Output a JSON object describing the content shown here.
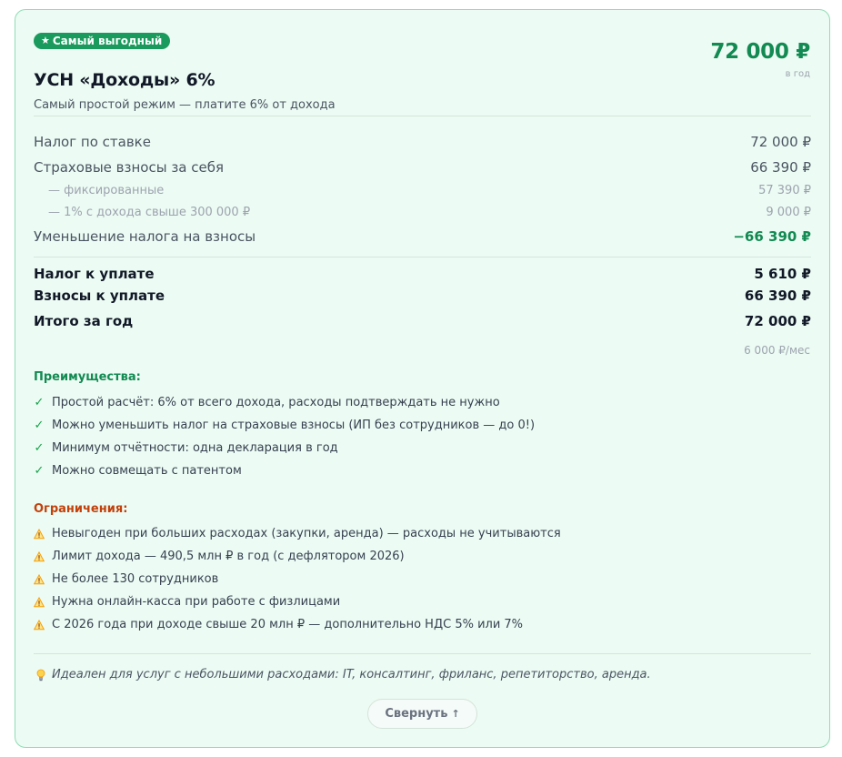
{
  "card": {
    "badge": "Самый выгодный",
    "title": "УСН «Доходы» 6%",
    "subtitle": "Самый простой режим — платите 6% от дохода",
    "price": "72 000 ₽",
    "period": "в год"
  },
  "breakdown": [
    {
      "label": "Налог по ставке",
      "value": "72 000 ₽"
    },
    {
      "label": "Страховые взносы за себя",
      "value": "66 390 ₽"
    },
    {
      "label": "— фиксированные",
      "value": "57 390 ₽"
    },
    {
      "label": "— 1% с дохода свыше 300 000 ₽",
      "value": "9 000 ₽"
    },
    {
      "label": "Уменьшение налога на взносы",
      "value": "−66 390 ₽"
    }
  ],
  "totals": [
    {
      "label": "Налог к уплате",
      "value": "5 610 ₽"
    },
    {
      "label": "Взносы к уплате",
      "value": "66 390 ₽"
    },
    {
      "label": "Итого за год",
      "value": "72 000 ₽"
    }
  ],
  "monthly": "6 000 ₽/мес",
  "advantages": {
    "title": "Преимущества:",
    "items": [
      "Простой расчёт: 6% от всего дохода, расходы подтверждать не нужно",
      "Можно уменьшить налог на страховые взносы (ИП без сотрудников — до 0!)",
      "Минимум отчётности: одна декларация в год",
      "Можно совмещать с патентом"
    ]
  },
  "limitations": {
    "title": "Ограничения:",
    "items": [
      "Невыгоден при больших расходах (закупки, аренда) — расходы не учитываются",
      "Лимит дохода — 490,5 млн ₽ в год (с дефлятором 2026)",
      "Не более 130 сотрудников",
      "Нужна онлайн-касса при работе с физлицами",
      "С 2026 года при доходе свыше 20 млн ₽ — дополнительно НДС 5% или 7%"
    ]
  },
  "tip": "Идеален для услуг с небольшими расходами: IT, консалтинг, фриланс, репетиторство, аренда.",
  "collapse_label": "Свернуть",
  "icons": {
    "badge": "star-icon",
    "advantage": "check-icon",
    "limitation": "warning-icon",
    "tip": "lightbulb-icon",
    "collapse": "arrow-up-icon"
  },
  "colors": {
    "accent": "#128a52",
    "badge_bg": "#1a9a5c",
    "card_bg": "#ecfbf3",
    "card_border": "#8fdcb4",
    "limitation_head": "#c2410c",
    "warning": "#f59e0b"
  }
}
